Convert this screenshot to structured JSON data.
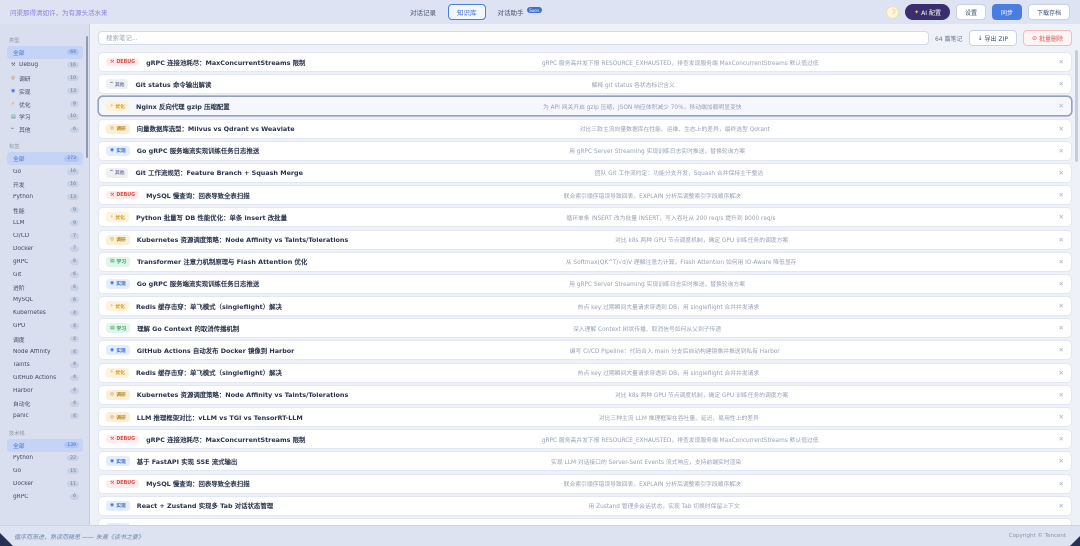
{
  "header": {
    "quote": "问渠那得清如许，为有源头活水来",
    "tabs": [
      {
        "label": "对话记录",
        "active": false,
        "badge": ""
      },
      {
        "label": "知识库",
        "active": true,
        "badge": ""
      },
      {
        "label": "对话助手",
        "active": false,
        "badge": "Soon"
      }
    ],
    "actions": {
      "theme_icon": "☽",
      "ai_icon": "✦",
      "ai_label": "AI 配置",
      "settings_label": "设置",
      "sync_label": "同步",
      "download_label": "下载存档"
    }
  },
  "sidebar": {
    "sections": [
      {
        "title": "类型",
        "items": [
          {
            "label": "全部",
            "count": "64",
            "icon": "",
            "icon_name": "",
            "icon_color": "",
            "active": true
          },
          {
            "label": "Debug",
            "count": "16",
            "icon": "⚒",
            "icon_name": "wrench-icon",
            "icon_color": "#5b6270",
            "active": false
          },
          {
            "label": "调研",
            "count": "10",
            "icon": "◎",
            "icon_name": "magnifier-icon",
            "icon_color": "#b9862a",
            "active": false
          },
          {
            "label": "实现",
            "count": "13",
            "icon": "◉",
            "icon_name": "target-icon",
            "icon_color": "#3e6fd0",
            "active": false
          },
          {
            "label": "优化",
            "count": "9",
            "icon": "⚡",
            "icon_name": "lightning-icon",
            "icon_color": "#e0a01f",
            "active": false
          },
          {
            "label": "学习",
            "count": "10",
            "icon": "▤",
            "icon_name": "book-icon",
            "icon_color": "#2f9e63",
            "active": false
          },
          {
            "label": "其他",
            "count": "6",
            "icon": "❝",
            "icon_name": "speech-bubble-icon",
            "icon_color": "#7a8299",
            "active": false
          }
        ]
      },
      {
        "title": "标签",
        "items": [
          {
            "label": "全部",
            "count": "273",
            "icon": "",
            "icon_name": "",
            "icon_color": "",
            "active": true
          },
          {
            "label": "Go",
            "count": "16",
            "icon": "",
            "icon_name": "",
            "icon_color": "",
            "active": false
          },
          {
            "label": "开发",
            "count": "16",
            "icon": "",
            "icon_name": "",
            "icon_color": "",
            "active": false
          },
          {
            "label": "Python",
            "count": "13",
            "icon": "",
            "icon_name": "",
            "icon_color": "",
            "active": false
          },
          {
            "label": "性能",
            "count": "9",
            "icon": "",
            "icon_name": "",
            "icon_color": "",
            "active": false
          },
          {
            "label": "LLM",
            "count": "9",
            "icon": "",
            "icon_name": "",
            "icon_color": "",
            "active": false
          },
          {
            "label": "CI/CD",
            "count": "7",
            "icon": "",
            "icon_name": "",
            "icon_color": "",
            "active": false
          },
          {
            "label": "Docker",
            "count": "7",
            "icon": "",
            "icon_name": "",
            "icon_color": "",
            "active": false
          },
          {
            "label": "gRPC",
            "count": "6",
            "icon": "",
            "icon_name": "",
            "icon_color": "",
            "active": false
          },
          {
            "label": "Git",
            "count": "6",
            "icon": "",
            "icon_name": "",
            "icon_color": "",
            "active": false
          },
          {
            "label": "进阶",
            "count": "6",
            "icon": "",
            "icon_name": "",
            "icon_color": "",
            "active": false
          },
          {
            "label": "MySQL",
            "count": "6",
            "icon": "",
            "icon_name": "",
            "icon_color": "",
            "active": false
          },
          {
            "label": "Kubernetes",
            "count": "4",
            "icon": "",
            "icon_name": "",
            "icon_color": "",
            "active": false
          },
          {
            "label": "GPU",
            "count": "4",
            "icon": "",
            "icon_name": "",
            "icon_color": "",
            "active": false
          },
          {
            "label": "调度",
            "count": "4",
            "icon": "",
            "icon_name": "",
            "icon_color": "",
            "active": false
          },
          {
            "label": "Node Affinity",
            "count": "4",
            "icon": "",
            "icon_name": "",
            "icon_color": "",
            "active": false
          },
          {
            "label": "Taints",
            "count": "4",
            "icon": "",
            "icon_name": "",
            "icon_color": "",
            "active": false
          },
          {
            "label": "GitHub Actions",
            "count": "4",
            "icon": "",
            "icon_name": "",
            "icon_color": "",
            "active": false
          },
          {
            "label": "Harbor",
            "count": "4",
            "icon": "",
            "icon_name": "",
            "icon_color": "",
            "active": false
          },
          {
            "label": "自动化",
            "count": "4",
            "icon": "",
            "icon_name": "",
            "icon_color": "",
            "active": false
          },
          {
            "label": "panic",
            "count": "4",
            "icon": "",
            "icon_name": "",
            "icon_color": "",
            "active": false
          }
        ]
      },
      {
        "title": "技术栈",
        "items": [
          {
            "label": "全部",
            "count": "139",
            "icon": "",
            "icon_name": "",
            "icon_color": "",
            "active": true
          },
          {
            "label": "Python",
            "count": "22",
            "icon": "",
            "icon_name": "",
            "icon_color": "",
            "active": false
          },
          {
            "label": "Go",
            "count": "15",
            "icon": "",
            "icon_name": "",
            "icon_color": "",
            "active": false
          },
          {
            "label": "Docker",
            "count": "11",
            "icon": "",
            "icon_name": "",
            "icon_color": "",
            "active": false
          },
          {
            "label": "gRPC",
            "count": "6",
            "icon": "",
            "icon_name": "",
            "icon_color": "",
            "active": false
          }
        ]
      }
    ]
  },
  "toolbar": {
    "search_placeholder": "搜索笔记...",
    "count_text": "64 篇笔记",
    "export_icon": "↓",
    "export_label": "导出 ZIP",
    "delete_icon": "⊘",
    "delete_label": "批量删除"
  },
  "badges": {
    "debug": {
      "label": "DEBUG",
      "icon": "⚒",
      "icon_name": "wrench-icon",
      "fg": "#e14a44",
      "bg": "#fdeceb"
    },
    "other": {
      "label": "其他",
      "icon": "❝",
      "icon_name": "speech-bubble-icon",
      "fg": "#7a8299",
      "bg": "#eef0f4"
    },
    "optimize": {
      "label": "优化",
      "icon": "⚡",
      "icon_name": "lightning-icon",
      "fg": "#e0961f",
      "bg": "#fdf3dc"
    },
    "research": {
      "label": "调研",
      "icon": "◎",
      "icon_name": "magnifier-icon",
      "fg": "#bd8b26",
      "bg": "#faf0d7"
    },
    "implement": {
      "label": "实现",
      "icon": "◉",
      "icon_name": "target-icon",
      "fg": "#3e6fd0",
      "bg": "#e4edfc"
    },
    "learn": {
      "label": "学习",
      "icon": "▤",
      "icon_name": "book-icon",
      "fg": "#2f9e63",
      "bg": "#e2f5ea"
    }
  },
  "close_icon": "✕",
  "notes": [
    {
      "type": "debug",
      "title": "gRPC 连接池耗尽：MaxConcurrentStreams 限制",
      "desc": "gRPC 服务高并发下报 RESOURCE_EXHAUSTED，排查发现服务端 MaxConcurrentStreams 默认值过低",
      "highlighted": false
    },
    {
      "type": "other",
      "title": "Git status 命令输出解读",
      "desc": "解释 git status 各状态标识含义",
      "highlighted": false
    },
    {
      "type": "optimize",
      "title": "Nginx 反向代理 gzip 压缩配置",
      "desc": "为 API 网关开启 gzip 压缩，JSON 响应体积减少 70%，移动端加载明显变快",
      "highlighted": true
    },
    {
      "type": "research",
      "title": "向量数据库选型：Milvus vs Qdrant vs Weaviate",
      "desc": "对比三款主流向量数据库在性能、运维、生态上的差异，最终选型 Qdrant",
      "highlighted": false
    },
    {
      "type": "implement",
      "title": "Go gRPC 服务端流实现训练任务日志推送",
      "desc": "用 gRPC Server Streaming 实现训练日志实时推送，替换轮询方案",
      "highlighted": false
    },
    {
      "type": "other",
      "title": "Git 工作流规范：Feature Branch + Squash Merge",
      "desc": "团队 Git 工作流约定：功能分支开发，Squash 合并保持主干整洁",
      "highlighted": false
    },
    {
      "type": "debug",
      "title": "MySQL 慢查询：回表导致全表扫描",
      "desc": "联合索引顺序错误导致回表，EXPLAIN 分析后调整索引字段顺序解决",
      "highlighted": false
    },
    {
      "type": "optimize",
      "title": "Python 批量写 DB 性能优化：单条 insert 改批量",
      "desc": "循环单条 INSERT 改为批量 INSERT，写入吞吐从 200 req/s 提升到 8000 req/s",
      "highlighted": false
    },
    {
      "type": "research",
      "title": "Kubernetes 资源调度策略：Node Affinity vs Taints/Tolerations",
      "desc": "对比 k8s 两种 GPU 节点调度机制，确定 GPU 训练任务的调度方案",
      "highlighted": false
    },
    {
      "type": "learn",
      "title": "Transformer 注意力机制原理与 Flash Attention 优化",
      "desc": "从 Softmax(QK^T/√d)V 理解注意力计算，Flash Attention 如何用 IO-Aware 降低显存",
      "highlighted": false
    },
    {
      "type": "implement",
      "title": "Go gRPC 服务端流实现训练任务日志推送",
      "desc": "用 gRPC Server Streaming 实现训练日志实时推送，替换轮询方案",
      "highlighted": false
    },
    {
      "type": "optimize",
      "title": "Redis 缓存击穿：单飞模式（singleflight）解决",
      "desc": "热点 key 过期瞬间大量请求穿透到 DB，用 singleflight 合并并发请求",
      "highlighted": false
    },
    {
      "type": "learn",
      "title": "理解 Go Context 的取消传播机制",
      "desc": "深入理解 Context 树状传播、取消信号如何从父到子传递",
      "highlighted": false
    },
    {
      "type": "implement",
      "title": "GitHub Actions 自动发布 Docker 镜像到 Harbor",
      "desc": "编写 CI/CD Pipeline：代码合入 main 分支后自动构建镜像并推送到私有 Harbor",
      "highlighted": false
    },
    {
      "type": "optimize",
      "title": "Redis 缓存击穿：单飞模式（singleflight）解决",
      "desc": "热点 key 过期瞬间大量请求穿透到 DB，用 singleflight 合并并发请求",
      "highlighted": false
    },
    {
      "type": "research",
      "title": "Kubernetes 资源调度策略：Node Affinity vs Taints/Tolerations",
      "desc": "对比 k8s 两种 GPU 节点调度机制，确定 GPU 训练任务的调度方案",
      "highlighted": false
    },
    {
      "type": "research",
      "title": "LLM 推理框架对比：vLLM vs TGI vs TensorRT-LLM",
      "desc": "对比三种主流 LLM 推理框架在吞吐量、延迟、易用性上的差异",
      "highlighted": false
    },
    {
      "type": "debug",
      "title": "gRPC 连接池耗尽：MaxConcurrentStreams 限制",
      "desc": "gRPC 服务高并发下报 RESOURCE_EXHAUSTED，排查发现服务端 MaxConcurrentStreams 默认值过低",
      "highlighted": false
    },
    {
      "type": "implement",
      "title": "基于 FastAPI 实现 SSE 流式输出",
      "desc": "实现 LLM 对话接口的 Server-Sent Events 流式响应，支持前端实时渲染",
      "highlighted": false
    },
    {
      "type": "debug",
      "title": "MySQL 慢查询：回表导致全表扫描",
      "desc": "联合索引顺序错误导致回表，EXPLAIN 分析后调整索引字段顺序解决",
      "highlighted": false
    },
    {
      "type": "implement",
      "title": "React + Zustand 实现多 Tab 对话状态管理",
      "desc": "用 Zustand 管理多会话状态，实现 Tab 切换时保留上下文",
      "highlighted": false
    },
    {
      "type": "implement",
      "title": "",
      "desc": "",
      "highlighted": false
    }
  ],
  "footer": {
    "quote": "循序而渐进，熟读而精思 —— 朱熹《读书之要》",
    "copyright": "Copyright © Tencent"
  }
}
